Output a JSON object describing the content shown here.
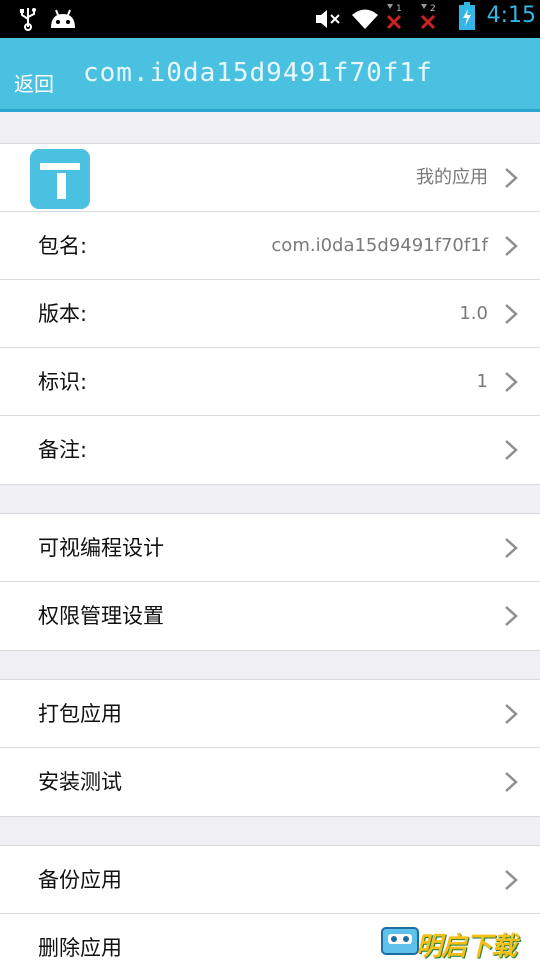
{
  "status_bar": {
    "time": "4:15",
    "signal_1_label": "1",
    "signal_2_label": "2",
    "icons": [
      "usb-icon",
      "android-icon",
      "mute-icon",
      "wifi-icon",
      "no-signal-icon",
      "no-signal-icon",
      "battery-charging-icon"
    ]
  },
  "header": {
    "back_label": "返回",
    "title": "com.i0da15d9491f70f1f"
  },
  "app_group": {
    "app_row_value": "我的应用",
    "rows": [
      {
        "label": "包名:",
        "value": "com.i0da15d9491f70f1f"
      },
      {
        "label": "版本:",
        "value": "1.0"
      },
      {
        "label": "标识:",
        "value": "1"
      },
      {
        "label": "备注:",
        "value": ""
      }
    ]
  },
  "design_group": {
    "rows": [
      {
        "label": "可视编程设计"
      },
      {
        "label": "权限管理设置"
      }
    ]
  },
  "build_group": {
    "rows": [
      {
        "label": "打包应用"
      },
      {
        "label": "安装测试"
      }
    ]
  },
  "manage_group": {
    "rows": [
      {
        "label": "备份应用"
      },
      {
        "label": "删除应用"
      }
    ]
  },
  "watermark": {
    "text": "明启下载"
  },
  "colors": {
    "accent": "#4bc1e1",
    "status_time": "#33b5e5",
    "page_background": "#efeff4"
  }
}
